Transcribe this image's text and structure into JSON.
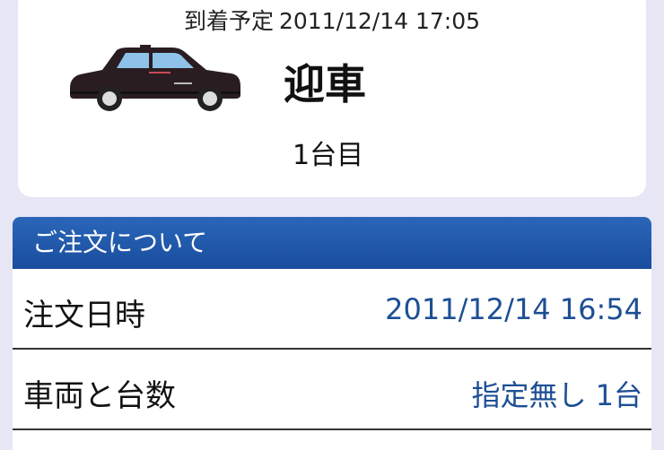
{
  "status": {
    "eta_label": "到着予定",
    "eta_time": "2011/12/14 17:05",
    "state": "迎車",
    "car_count": "1台目"
  },
  "order": {
    "header": "ご注文について",
    "rows": [
      {
        "label": "注文日時",
        "value": "2011/12/14 16:54"
      },
      {
        "label": "車両と台数",
        "value": "指定無し 1台"
      }
    ]
  },
  "colors": {
    "page_bg": "#e6e6f4",
    "header_bg": "#1a4d9e",
    "value_text": "#1d4f94"
  },
  "icons": {
    "vehicle": "taxi-icon"
  }
}
